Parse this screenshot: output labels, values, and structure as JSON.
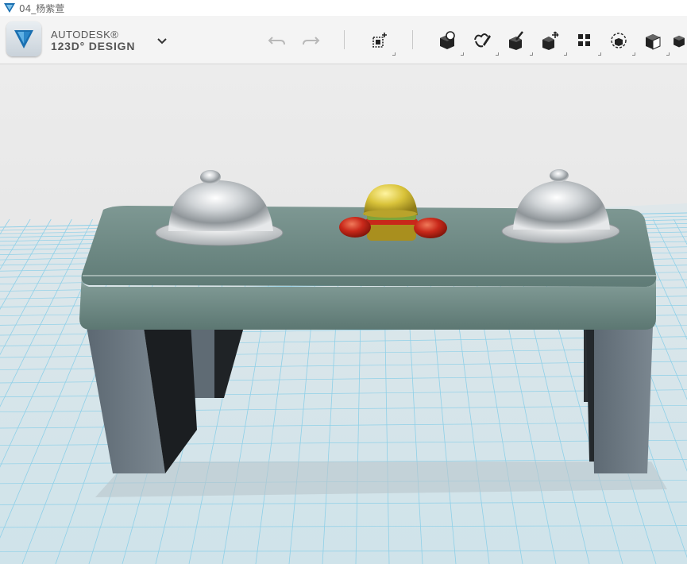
{
  "window": {
    "title": "04_杨紫萱"
  },
  "brand": {
    "line1": "AUTODESK®",
    "line2": "123D° DESIGN"
  },
  "toolbar": {
    "icons": [
      "undo-icon",
      "redo-icon",
      "transform-icon",
      "primitives-icon",
      "sketch-icon",
      "construct-icon",
      "modify-icon",
      "pattern-icon",
      "grouping-icon",
      "combine-icon",
      "measure-icon"
    ]
  },
  "colors": {
    "accent": "#1a6fb0",
    "grid": "#7fc9e6",
    "table_top": "#6f8c86",
    "legs": "#6e7a84",
    "dome": "#d7dadc",
    "bun": "#d8c23a",
    "patty": "#c62b1a"
  }
}
